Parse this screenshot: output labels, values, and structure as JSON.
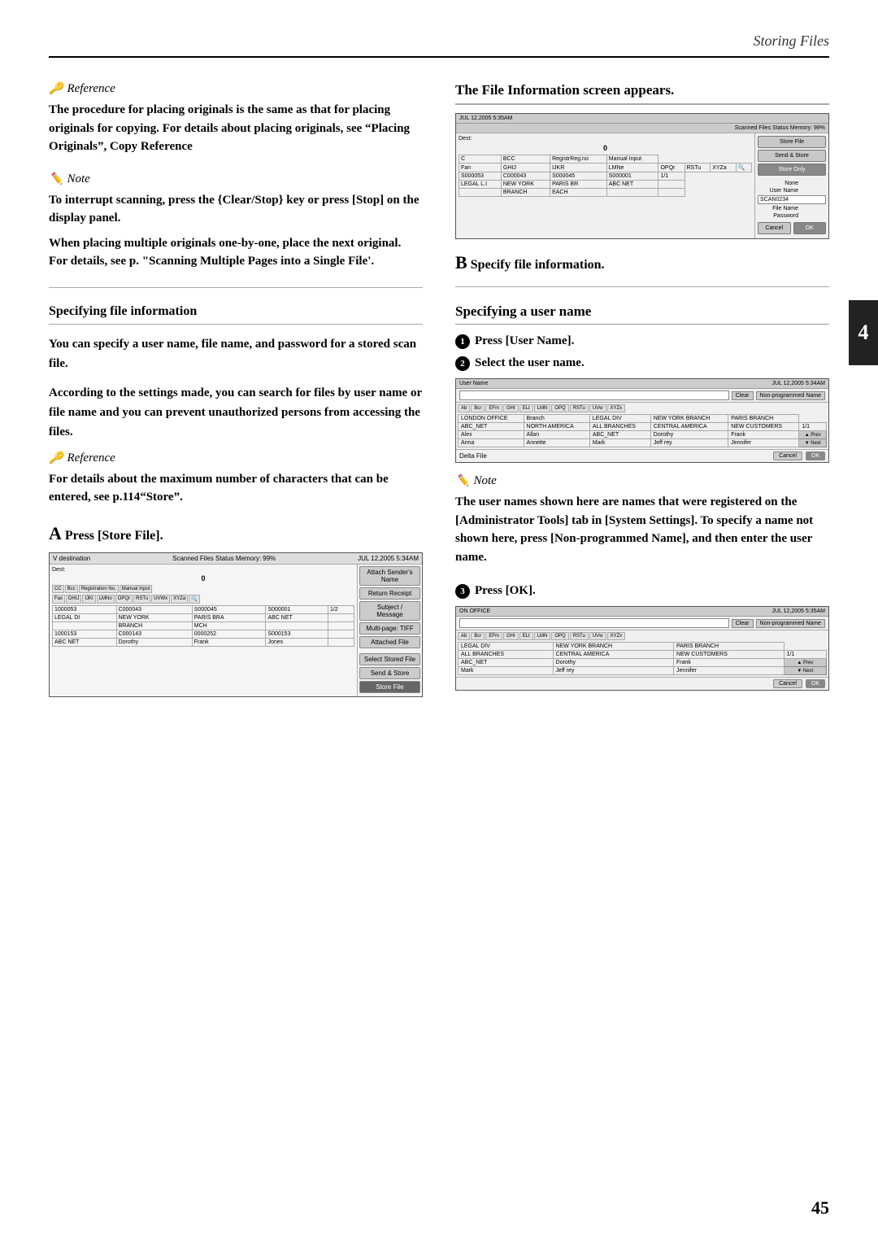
{
  "header": {
    "title": "Storing Files"
  },
  "page_number": "45",
  "left_col": {
    "reference1": {
      "label": "Reference",
      "text": "The procedure for placing originals is the same as that for placing originals for copying. For details about placing originals, see “Placing Originals”, Copy Reference"
    },
    "note1": {
      "label": "Note",
      "lines": [
        "To interrupt scanning, press the {Clear/Stop} key or press [Stop] on the display panel.",
        "When placing multiple originals one-by-one, place the next original. For details, see p. “Scanning Multiple Pages into a Single File’."
      ]
    },
    "specifying_section": {
      "heading": "Specifying file information",
      "body1": "You can specify a user name, file name, and password for a stored scan file.",
      "body2": "According to the settings made, you can search for files by user name or file name and you can prevent unauthorized persons from accessing the files."
    },
    "reference2": {
      "label": "Reference",
      "text": "For details about the maximum number of characters that can be entered, see p.114“Store”."
    },
    "step_a": {
      "label": "A",
      "text": "Press [Store File]."
    },
    "screen1": {
      "titlebar_left": "V destination",
      "titlebar_right": "JUL 12,2005 5:34AM",
      "memory": "Scanned Files Status Memory: 99%",
      "attach": "Attach Sender's Name",
      "return": "Return Receipt",
      "subject": "Subject / Message",
      "multipage": "Multi-page: TIFF",
      "attached": "Attached File",
      "select_stored": "Select Stored File",
      "send_store": "Send & Store",
      "store_file": "Store File",
      "table_rows": [
        [
          "1000053",
          "C000043",
          "S000045",
          "S000001",
          "1/2",
          "LEGAL DI",
          "NEW YORK",
          "PARIS BRA",
          "ABC NET",
          "",
          "BRANCH",
          "MCH"
        ],
        [
          "1000153",
          "C000143",
          "0000252",
          "S000153",
          "",
          "ABC NET",
          "Dorothy",
          "Frank",
          "Jones"
        ]
      ]
    }
  },
  "right_col": {
    "file_info_heading": "The File Information screen appears.",
    "screen2": {
      "titlebar": "JUL 12,2005 5:35AM",
      "memory": "Memory: 99%",
      "store_file_btn": "Store File",
      "send_store_btn": "Send & Store",
      "store_only_btn": "Store Only",
      "dest_label": "Dest:",
      "count": "0",
      "fields": [
        {
          "label": "None",
          "value": ""
        },
        {
          "label": "User Name",
          "value": "SCAN0234"
        },
        {
          "label": "File Name",
          "value": ""
        },
        {
          "label": "Password",
          "value": ""
        }
      ],
      "cancel_btn": "Cancel",
      "ok_btn": "OK"
    },
    "step_b": {
      "label": "B",
      "text": "Specify file information."
    },
    "specifying_user_name": {
      "heading": "Specifying a user name",
      "sub_steps": [
        {
          "num": "1",
          "text": "Press [User Name]."
        },
        {
          "num": "2",
          "text": "Select the user name."
        }
      ]
    },
    "user_screen": {
      "titlebar": "JUL 12,2005 5:34AM",
      "title_label": "User Name",
      "clear_btn": "Clear",
      "np_btn": "Non-programmed Name",
      "headers": [
        "Ab",
        "Bcr",
        "EFm",
        "GHI",
        "ELt",
        "LMN",
        "OPQ",
        "RSTu",
        "UVw",
        "XYZx"
      ],
      "rows": [
        [
          "LONDON OFFICE",
          "Branch",
          "LEGAL DIV",
          "NEW YORK BRANCH",
          "PARIS BRANCH"
        ],
        [
          "ABC_NET",
          "NORTH AMERICA",
          "ALL BRANCHES",
          "CENTRAL AMERICA",
          "NEW CUSTOMERS",
          "1/1"
        ],
        [
          "Alex",
          "Allan",
          "ABC_NET",
          "Dorothy",
          "Frank",
          "▲ Prev"
        ],
        [
          "Anna",
          "Annette",
          "Mark",
          "Jeff rey",
          "Jennifer",
          "▼ Next"
        ],
        [
          "Delta File",
          "",
          "",
          "",
          "Cancel",
          "OK"
        ]
      ]
    },
    "note2": {
      "label": "Note",
      "text": "The user names shown here are names that were registered on the [Administrator Tools] tab in [System Settings]. To specify a name not shown here, press [Non-programmed Name], and then enter the user name."
    },
    "step3": {
      "num": "3",
      "text": "Press [OK]."
    },
    "user_screen2": {
      "titlebar": "JUL 12,2005 5:35AM",
      "title_label": "ON OFFICE",
      "clear_btn": "Clear",
      "np_btn": "Non-programmed Name",
      "headers": [
        "Ab",
        "Bcr",
        "EFm",
        "GHI",
        "ELt",
        "LMN",
        "OPQ",
        "RSTu",
        "UVw",
        "XYZx"
      ],
      "rows": [
        [
          "LEGAL DIV",
          "NEW YORK BRANCH",
          "PARIS BRANCH"
        ],
        [
          "ALL BRANCHES",
          "CENTRAL AMERICA",
          "NEW CUSTOMERS",
          "1/1"
        ],
        [
          "ABC_NET",
          "Dorothy",
          "Frank",
          "▲ Prev"
        ],
        [
          "Mark",
          "Jeff rey",
          "Jennifer",
          "▼ Next"
        ],
        [
          "",
          "",
          "Cancel",
          "OK"
        ]
      ]
    }
  },
  "side_tab": "4"
}
